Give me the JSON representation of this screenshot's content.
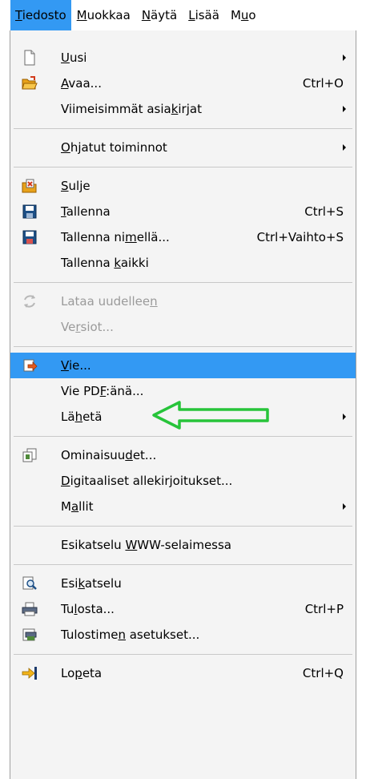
{
  "menubar": {
    "items": [
      {
        "pre": "",
        "u": "T",
        "post": "iedosto"
      },
      {
        "pre": "",
        "u": "M",
        "post": "uokkaa"
      },
      {
        "pre": "",
        "u": "N",
        "post": "äytä"
      },
      {
        "pre": "",
        "u": "L",
        "post": "isää"
      },
      {
        "pre": "M",
        "u": "u",
        "post": "o"
      }
    ]
  },
  "menu": {
    "items": [
      {
        "pre": "",
        "u": "U",
        "post": "usi",
        "shortcut": "",
        "icon": "new-document-icon"
      },
      {
        "pre": "",
        "u": "A",
        "post": "vaa...",
        "shortcut": "Ctrl+O",
        "icon": "open-folder-icon"
      },
      {
        "pre": "Viimeisimmät asia",
        "u": "k",
        "post": "irjat",
        "shortcut": "",
        "icon": ""
      },
      {
        "pre": "",
        "u": "O",
        "post": "hjatut toiminnot",
        "shortcut": "",
        "icon": ""
      },
      {
        "pre": "",
        "u": "S",
        "post": "ulje",
        "shortcut": "",
        "icon": "close-document-icon"
      },
      {
        "pre": "",
        "u": "T",
        "post": "allenna",
        "shortcut": "Ctrl+S",
        "icon": "save-icon"
      },
      {
        "pre": "Tallenna ni",
        "u": "m",
        "post": "ellä...",
        "shortcut": "Ctrl+Vaihto+S",
        "icon": "save-as-icon"
      },
      {
        "pre": "Tallenna ",
        "u": "k",
        "post": "aikki",
        "shortcut": "",
        "icon": ""
      },
      {
        "pre": "Lataa uudellee",
        "u": "n",
        "post": "",
        "shortcut": "",
        "icon": "reload-icon"
      },
      {
        "pre": "Ve",
        "u": "r",
        "post": "siot...",
        "shortcut": "",
        "icon": ""
      },
      {
        "pre": "",
        "u": "V",
        "post": "ie...",
        "shortcut": "",
        "icon": "export-icon"
      },
      {
        "pre": "Vie PD",
        "u": "F",
        "post": ":änä...",
        "shortcut": "",
        "icon": ""
      },
      {
        "pre": "Lä",
        "u": "h",
        "post": "etä",
        "shortcut": "",
        "icon": ""
      },
      {
        "pre": "Ominaisuu",
        "u": "d",
        "post": "et...",
        "shortcut": "",
        "icon": "properties-icon"
      },
      {
        "pre": "",
        "u": "D",
        "post": "igitaaliset allekirjoitukset...",
        "shortcut": "",
        "icon": ""
      },
      {
        "pre": "M",
        "u": "a",
        "post": "llit",
        "shortcut": "",
        "icon": ""
      },
      {
        "pre": "Esikatselu ",
        "u": "W",
        "post": "WW-selaimessa",
        "shortcut": "",
        "icon": ""
      },
      {
        "pre": "Esi",
        "u": "k",
        "post": "atselu",
        "shortcut": "",
        "icon": "print-preview-icon"
      },
      {
        "pre": "Tu",
        "u": "l",
        "post": "osta...",
        "shortcut": "Ctrl+P",
        "icon": "print-icon"
      },
      {
        "pre": "Tulostime",
        "u": "n",
        "post": " asetukset...",
        "shortcut": "",
        "icon": "printer-settings-icon"
      },
      {
        "pre": "Lo",
        "u": "p",
        "post": "eta",
        "shortcut": "Ctrl+Q",
        "icon": "exit-icon"
      }
    ]
  },
  "colors": {
    "highlight": "#3399f3",
    "annotation_arrow": "#27c43a",
    "menu_background": "#f4f4f4"
  }
}
